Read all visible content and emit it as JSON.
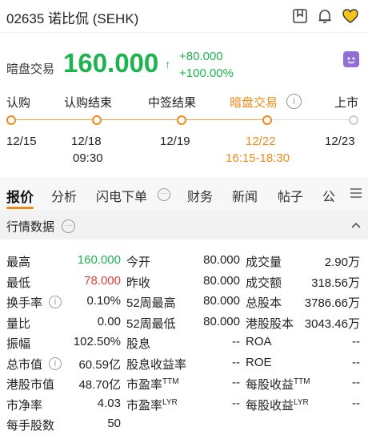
{
  "header": {
    "title": "02635 诺比侃 (SEHK)"
  },
  "quote": {
    "label": "暗盘交易",
    "price": "160.000",
    "change": "+80.000",
    "change_pct": "+100.00%"
  },
  "timeline": {
    "steps": [
      {
        "label": "认购",
        "date": "12/15",
        "date2": ""
      },
      {
        "label": "认购结束",
        "date": "12/18",
        "date2": "09:30"
      },
      {
        "label": "中签结果",
        "date": "12/19",
        "date2": ""
      },
      {
        "label": "暗盘交易",
        "date": "12/22",
        "date2": "16:15-18:30"
      },
      {
        "label": "上市",
        "date": "12/23",
        "date2": ""
      }
    ]
  },
  "tabs": [
    "报价",
    "分析",
    "闪电下单",
    "财务",
    "新闻",
    "帖子",
    "公"
  ],
  "section": {
    "title": "行情数据"
  },
  "stats": {
    "col1": [
      {
        "label": "最高",
        "value": "160.000"
      },
      {
        "label": "最低",
        "value": "78.000"
      },
      {
        "label": "换手率",
        "value": "0.10%"
      },
      {
        "label": "量比",
        "value": "0.00"
      },
      {
        "label": "振幅",
        "value": "102.50%"
      },
      {
        "label": "总市值",
        "value": "60.59亿"
      },
      {
        "label": "港股市值",
        "value": "48.70亿"
      },
      {
        "label": "市净率",
        "value": "4.03"
      },
      {
        "label": "每手股数",
        "value": "50"
      }
    ],
    "col2": [
      {
        "label": "今开",
        "sup": "",
        "value": "80.000"
      },
      {
        "label": "昨收",
        "sup": "",
        "value": "80.000"
      },
      {
        "label": "52周最高",
        "sup": "",
        "value": "80.000"
      },
      {
        "label": "52周最低",
        "sup": "",
        "value": "80.000"
      },
      {
        "label": "股息",
        "sup": "",
        "value": "--"
      },
      {
        "label": "股息收益率",
        "sup": "",
        "value": "--"
      },
      {
        "label": "市盈率",
        "sup": "TTM",
        "value": "--"
      },
      {
        "label": "市盈率",
        "sup": "LYR",
        "value": "--"
      }
    ],
    "col3": [
      {
        "label": "成交量",
        "sup": "",
        "value": "2.90万"
      },
      {
        "label": "成交额",
        "sup": "",
        "value": "318.56万"
      },
      {
        "label": "总股本",
        "sup": "",
        "value": "3786.66万"
      },
      {
        "label": "港股股本",
        "sup": "",
        "value": "3043.46万"
      },
      {
        "label": "ROA",
        "sup": "",
        "value": "--"
      },
      {
        "label": "ROE",
        "sup": "",
        "value": "--"
      },
      {
        "label": "每股收益",
        "sup": "TTM",
        "value": "--"
      },
      {
        "label": "每股收益",
        "sup": "LYR",
        "value": "--"
      }
    ]
  }
}
